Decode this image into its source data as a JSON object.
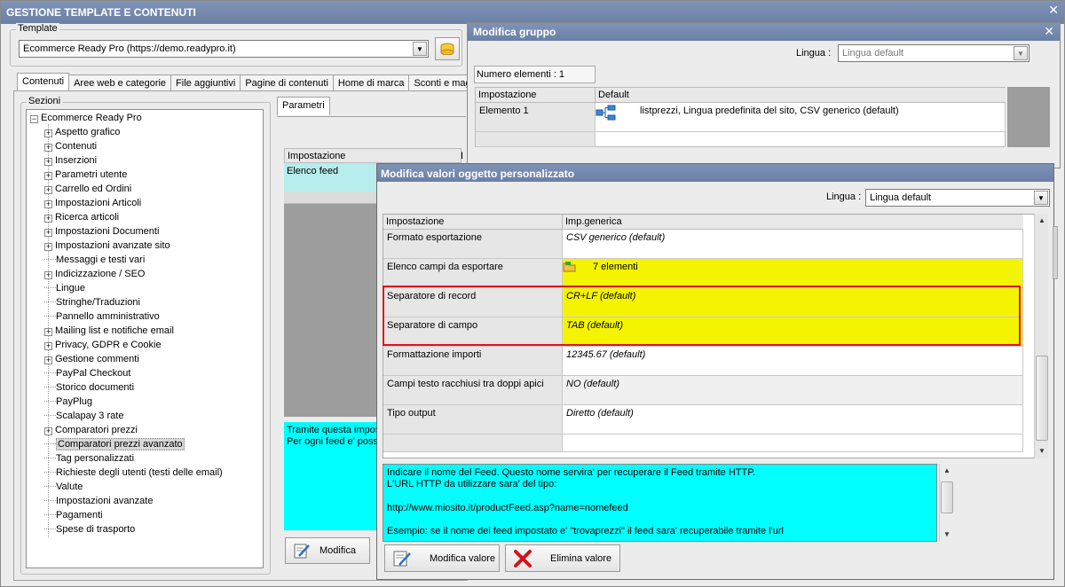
{
  "main": {
    "title": "GESTIONE TEMPLATE E CONTENUTI",
    "template_label": "Template",
    "template_value": "Ecommerce Ready Pro (https://demo.readypro.it)",
    "tabs": [
      "Contenuti",
      "Aree web e categorie",
      "File aggiuntivi",
      "Pagine di contenuti",
      "Home di marca",
      "Sconti e mag"
    ],
    "sections_label": "Sezioni",
    "tree_root": "Ecommerce Ready Pro",
    "tree_items": [
      {
        "label": "Aspetto grafico",
        "expandable": true
      },
      {
        "label": "Contenuti",
        "expandable": true
      },
      {
        "label": "Inserzioni",
        "expandable": true
      },
      {
        "label": "Parametri utente",
        "expandable": true
      },
      {
        "label": "Carrello ed Ordini",
        "expandable": true
      },
      {
        "label": "Impostazioni Articoli",
        "expandable": true
      },
      {
        "label": "Ricerca articoli",
        "expandable": true
      },
      {
        "label": "Impostazioni Documenti",
        "expandable": true
      },
      {
        "label": "Impostazioni avanzate sito",
        "expandable": true
      },
      {
        "label": "Messaggi e testi vari",
        "expandable": false
      },
      {
        "label": "Indicizzazione / SEO",
        "expandable": true
      },
      {
        "label": "Lingue",
        "expandable": false
      },
      {
        "label": "Stringhe/Traduzioni",
        "expandable": false
      },
      {
        "label": "Pannello amministrativo",
        "expandable": false
      },
      {
        "label": "Mailing list e notifiche email",
        "expandable": true
      },
      {
        "label": "Privacy, GDPR e Cookie",
        "expandable": true
      },
      {
        "label": "Gestione commenti",
        "expandable": true
      },
      {
        "label": "PayPal Checkout",
        "expandable": false
      },
      {
        "label": "Storico documenti",
        "expandable": false
      },
      {
        "label": "PayPlug",
        "expandable": false
      },
      {
        "label": "Scalapay 3 rate",
        "expandable": false
      },
      {
        "label": "Comparatori prezzi",
        "expandable": true
      },
      {
        "label": "Comparatori prezzi avanzato",
        "expandable": false,
        "selected": true
      },
      {
        "label": "Tag personalizzati",
        "expandable": false
      },
      {
        "label": "Richieste degli utenti (testi delle email)",
        "expandable": false
      },
      {
        "label": "Valute",
        "expandable": false
      },
      {
        "label": "Impostazioni avanzate",
        "expandable": false
      },
      {
        "label": "Pagamenti",
        "expandable": false
      },
      {
        "label": "Spese di trasporto",
        "expandable": false
      }
    ],
    "params_tab": "Parametri",
    "params_header": "Impostazione",
    "params_header2": "I",
    "params_row": "Elenco feed",
    "desc_line1": "Tramite questa impos",
    "desc_line2": "Per ogni feed e' possi",
    "modifica_button": "Modifica"
  },
  "group": {
    "title": "Modifica gruppo",
    "lingua_label": "Lingua :",
    "lingua_value": "Lingua default",
    "count_label": "Numero elementi : 1",
    "col1": "Impostazione",
    "col2": "Default",
    "row_name": "Elemento 1",
    "row_value": "listprezzi, Lingua predefinita del sito, CSV generico (default)"
  },
  "custom": {
    "title": "Modifica valori oggetto personalizzato",
    "lingua_label": "Lingua :",
    "lingua_value": "Lingua default",
    "col1": "Impostazione",
    "col2": "Imp.generica",
    "rows": [
      {
        "name": "Formato esportazione",
        "value": "CSV generico (default)",
        "style": "white"
      },
      {
        "name": "Elenco campi da esportare",
        "value": "7 elementi",
        "style": "yellow"
      },
      {
        "name": "Separatore di record",
        "value": "CR+LF (default)",
        "style": "yellow"
      },
      {
        "name": "Separatore di campo",
        "value": "TAB (default)",
        "style": "yellow"
      },
      {
        "name": "Formattazione importi",
        "value": "12345.67 (default)",
        "style": "white"
      },
      {
        "name": "Campi testo racchiusi tra doppi apici",
        "value": "NO (default)",
        "style": "grey"
      },
      {
        "name": "Tipo output",
        "value": "Diretto (default)",
        "style": "white"
      }
    ],
    "description": [
      "Indicare il nome del Feed. Questo nome servira' per recuperare il Feed tramite HTTP.",
      "L'URL HTTP da utilizzare sara' del tipo:",
      "",
      "http://www.miosito.it/productFeed.asp?name=nomefeed",
      "",
      "Esempio: se il nome del feed impostato e'  \"trovaprezzi\" il feed sara' recuperabile tramite l'url"
    ],
    "btn_modify": "Modifica valore",
    "btn_delete": "Elimina valore"
  },
  "colors": {
    "title_bar": "#7489ad",
    "cyan": "#00ffff",
    "yellow": "#f4f400",
    "highlight_border": "#e1141b"
  }
}
